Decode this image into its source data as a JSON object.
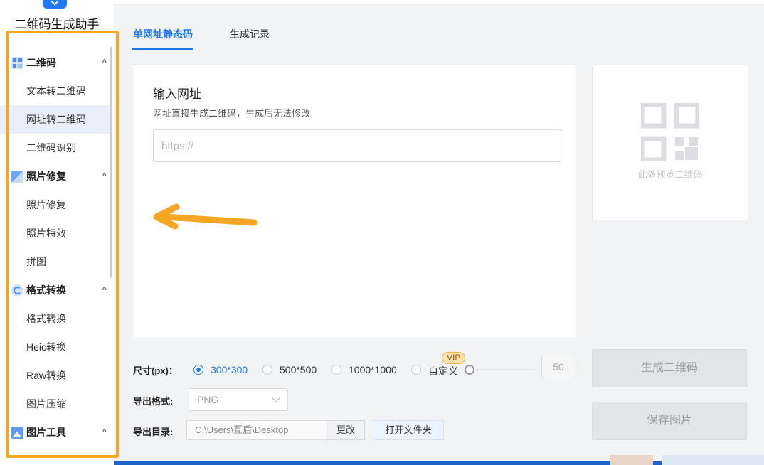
{
  "app": {
    "title": "二维码生成助手"
  },
  "sidebar": {
    "groups": [
      {
        "label": "二维码",
        "icon": "qrcode-icon",
        "chevron": "^"
      },
      {
        "label": "照片修复",
        "icon": "photo-icon",
        "chevron": "^"
      },
      {
        "label": "格式转换",
        "icon": "convert-icon",
        "chevron": "^"
      },
      {
        "label": "图片工具",
        "icon": "image-tools-icon",
        "chevron": "^"
      }
    ],
    "items": [
      {
        "label": "文本转二维码"
      },
      {
        "label": "网址转二维码",
        "active": true
      },
      {
        "label": "二维码识别"
      },
      {
        "label": "照片修复"
      },
      {
        "label": "照片特效"
      },
      {
        "label": "拼图"
      },
      {
        "label": "格式转换"
      },
      {
        "label": "Heic转换"
      },
      {
        "label": "Raw转换"
      },
      {
        "label": "图片压缩"
      }
    ]
  },
  "tabs": [
    {
      "label": "单网址静态码",
      "active": true
    },
    {
      "label": "生成记录"
    }
  ],
  "input_panel": {
    "title": "输入网址",
    "hint": "网址直接生成二维码，生成后无法修改",
    "placeholder": "https://",
    "value": ""
  },
  "preview": {
    "text": "此处预览二维码"
  },
  "options": {
    "size_label": "尺寸(px)",
    "sizes": [
      {
        "label": "300*300",
        "checked": true
      },
      {
        "label": "500*500"
      },
      {
        "label": "1000*1000"
      },
      {
        "label": "自定义"
      }
    ],
    "vip_badge": "VIP",
    "custom_value": "50",
    "format_label": "导出格式",
    "format_value": "PNG",
    "dir_label": "导出目录",
    "dir_value": "C:\\Users\\互盾\\Desktop",
    "change_label": "更改",
    "open_folder_label": "打开文件夹"
  },
  "actions": {
    "generate_label": "生成二维码",
    "save_label": "保存图片"
  },
  "colors": {
    "accent": "#1e75f0",
    "annotation": "#f5a623"
  }
}
